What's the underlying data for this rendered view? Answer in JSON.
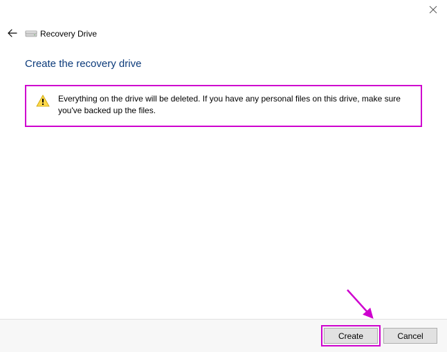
{
  "window": {
    "title": "Recovery Drive"
  },
  "page": {
    "heading": "Create the recovery drive",
    "warning": "Everything on the drive will be deleted. If you have any personal files on this drive, make sure you've backed up the files."
  },
  "buttons": {
    "create": "Create",
    "cancel": "Cancel"
  },
  "icons": {
    "close": "close-icon",
    "back": "back-arrow-icon",
    "drive": "drive-icon",
    "warning": "warning-triangle-icon"
  },
  "annotation": {
    "color": "#ce00ce"
  }
}
